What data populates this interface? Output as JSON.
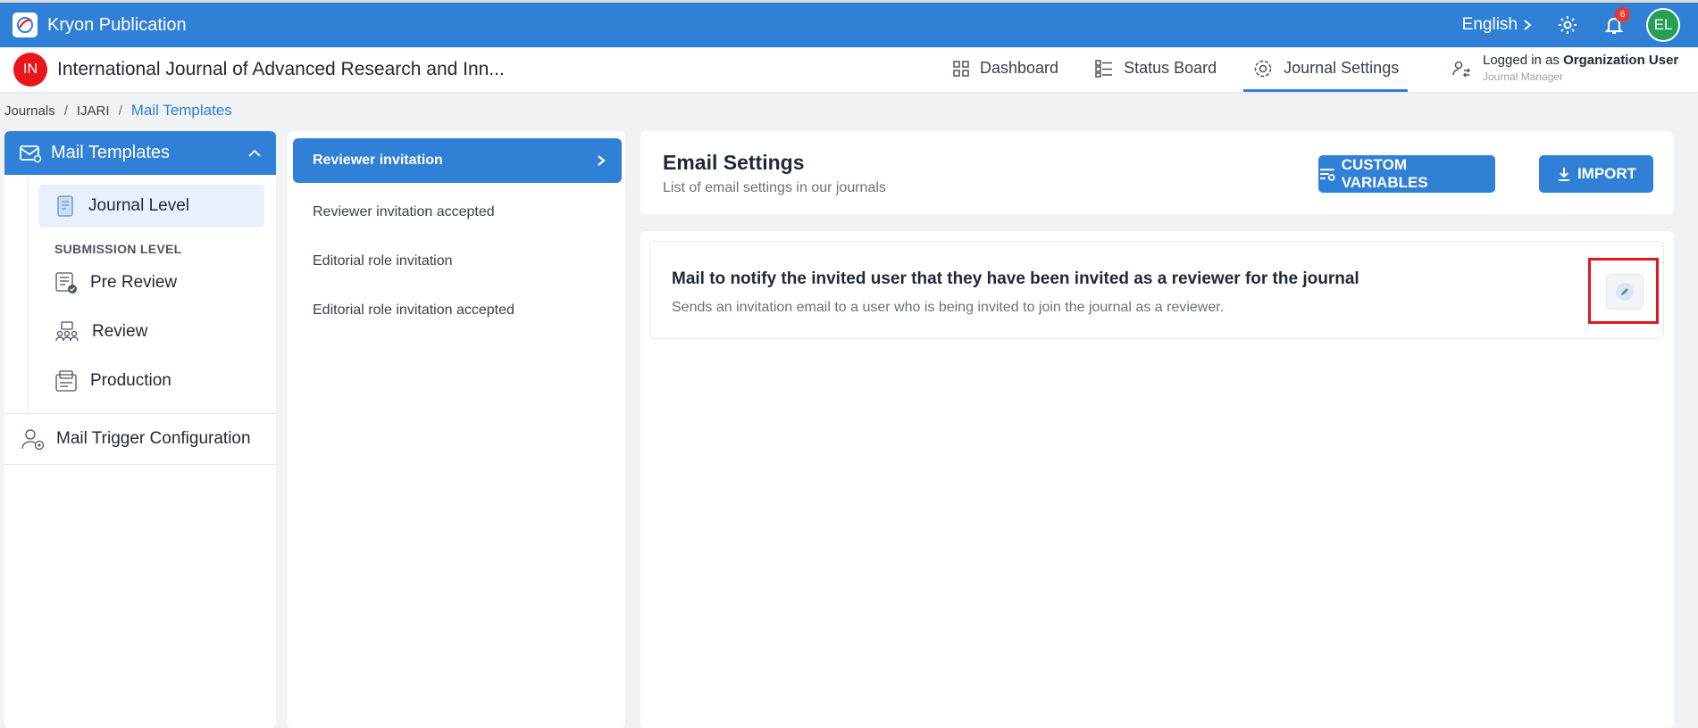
{
  "app": {
    "title": "Kryon Publication"
  },
  "topbar": {
    "language": "English",
    "notification_count": "6",
    "avatar_initials": "EL"
  },
  "journal": {
    "badge": "IN",
    "title": "International Journal of Advanced Research and Inn..."
  },
  "nav": {
    "dashboard": "Dashboard",
    "status_board": "Status Board",
    "journal_settings": "Journal Settings"
  },
  "user": {
    "logged_prefix": "Logged in as",
    "name": "Organization User",
    "role": "Journal Manager"
  },
  "breadcrumb": {
    "items": [
      "Journals",
      "IJARI",
      "Mail Templates"
    ],
    "separator": "/"
  },
  "sidebar": {
    "header": "Mail Templates",
    "journal_level": "Journal Level",
    "submission_level_heading": "SUBMISSION LEVEL",
    "items": [
      "Pre Review",
      "Review",
      "Production"
    ],
    "mail_trigger": "Mail Trigger Configuration"
  },
  "templates": {
    "items": [
      "Reviewer invitation",
      "Reviewer invitation accepted",
      "Editorial role invitation",
      "Editorial role invitation accepted"
    ]
  },
  "email_settings": {
    "title": "Email Settings",
    "subtitle": "List of email settings in our journals",
    "custom_variables": "CUSTOM VARIABLES",
    "import": "IMPORT"
  },
  "mail": {
    "title": "Mail to notify the invited user that they have been invited as a reviewer for the journal",
    "description": "Sends an invitation email to a user who is being invited to join the journal as a reviewer."
  },
  "colors": {
    "primary": "#2f80d6",
    "highlight": "#e0191e",
    "journal_badge": "#e8151b",
    "avatar": "#25a055"
  },
  "icons": [
    "app-logo-icon",
    "chevron-right-icon",
    "gear-icon",
    "bell-icon",
    "dashboard-grid-icon",
    "status-board-icon",
    "settings-cog-icon",
    "user-switch-icon",
    "mail-icon",
    "chevron-up-icon",
    "journal-level-icon",
    "pre-review-icon",
    "review-icon",
    "production-icon",
    "mail-trigger-icon",
    "filter-list-icon",
    "download-icon",
    "pencil-icon"
  ]
}
